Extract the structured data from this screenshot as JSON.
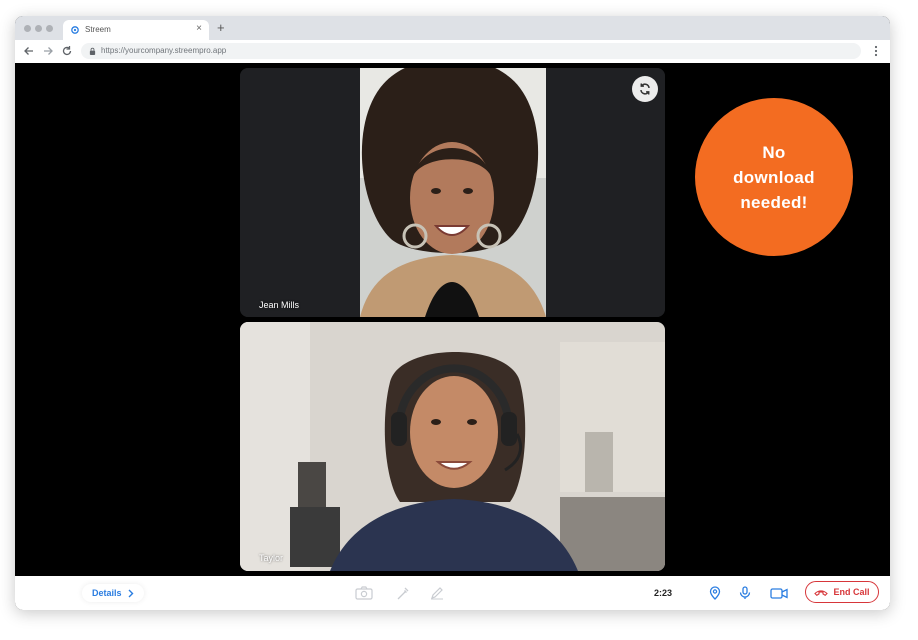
{
  "browser": {
    "tab_title": "Streem",
    "url": "https://yourcompany.streempro.app",
    "icons": [
      "back-arrow-icon",
      "forward-arrow-icon",
      "reload-icon",
      "lock-icon",
      "more-vert-icon",
      "plus-icon",
      "close-icon"
    ]
  },
  "participants": [
    {
      "name": "Jean Mills"
    },
    {
      "name": "Taylor"
    }
  ],
  "badge": {
    "lines": [
      "No",
      "download",
      "needed!"
    ],
    "color": "#f36c21"
  },
  "callbar": {
    "details_label": "Details",
    "timer": "2:23",
    "end_call_label": "End Call",
    "accent": "#2a7de1",
    "danger": "#d7363a",
    "tools": [
      "camera-icon",
      "eyedropper-icon",
      "pencil-icon"
    ],
    "controls": [
      "location-pin-icon",
      "microphone-icon",
      "video-camera-icon"
    ]
  }
}
